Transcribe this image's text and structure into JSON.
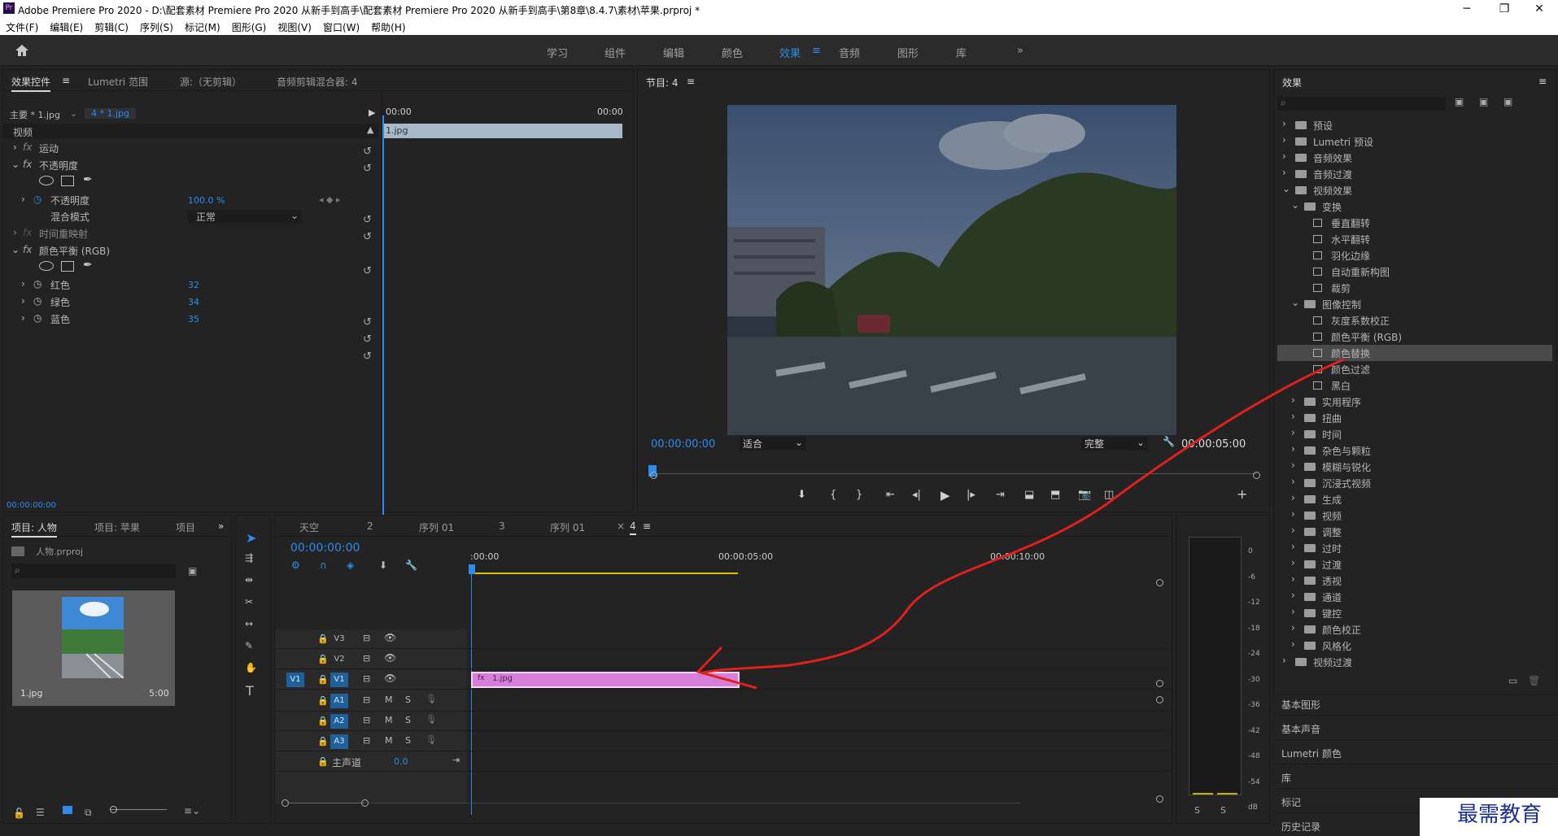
{
  "titlebar": {
    "logo": "Pr",
    "title": "Adobe Premiere Pro 2020 - D:\\配套素材 Premiere Pro 2020 从新手到高手\\配套素材 Premiere Pro 2020 从新手到高手\\第8章\\8.4.7\\素材\\苹果.prproj *",
    "minimize": "─",
    "maximize": "❐",
    "close": "✕"
  },
  "menu": [
    "文件(F)",
    "编辑(E)",
    "剪辑(C)",
    "序列(S)",
    "标记(M)",
    "图形(G)",
    "视图(V)",
    "窗口(W)",
    "帮助(H)"
  ],
  "workspaces": {
    "home_icon": "home-icon",
    "items": [
      "学习",
      "组件",
      "编辑",
      "颜色",
      "效果",
      "音频",
      "图形",
      "库"
    ],
    "active": "效果",
    "more": "»"
  },
  "effect_controls": {
    "tabs": [
      "效果控件",
      "Lumetri 范围",
      "源:（无剪辑）",
      "音频剪辑混合器: 4"
    ],
    "menu_icon": "≡",
    "master": "主要 * 1.jpg",
    "seq_clip": "4 * 1.jpg",
    "ruler_start": "00:00",
    "ruler_end": "00:00",
    "clip_label": "1.jpg",
    "section_video": "视频",
    "motion": "运动",
    "opacity": "不透明度",
    "opacity_value_label": "不透明度",
    "opacity_value": "100.0 %",
    "blend_mode_label": "混合模式",
    "blend_mode": "正常",
    "time_remap": "时间重映射",
    "color_balance": "颜色平衡 (RGB)",
    "red_label": "红色",
    "red": "32",
    "green_label": "绿色",
    "green": "34",
    "blue_label": "蓝色",
    "blue": "35",
    "timecode": "00:00:00:00"
  },
  "program": {
    "title": "节目: 4",
    "timecode": "00:00:00:00",
    "fit": "适合",
    "quality": "完整",
    "duration": "00:00:05:00",
    "add_icon": "+"
  },
  "project": {
    "tabs": [
      "项目: 人物",
      "项目: 苹果",
      "项目"
    ],
    "more": "»",
    "file": "人物.prproj",
    "clip_name": "1.jpg",
    "clip_duration": "5:00"
  },
  "timeline": {
    "tabs": [
      "天空",
      "2",
      "序列 01",
      "3",
      "序列 01",
      "4"
    ],
    "close_mark": "×",
    "timecode": "00:00:00:00",
    "ruler": [
      ":00:00",
      "00:00:05:00",
      "00:00:10:00"
    ],
    "video_tracks": [
      "V3",
      "V2",
      "V1"
    ],
    "audio_tracks": [
      "A1",
      "A2",
      "A3"
    ],
    "source_v1": "V1",
    "master": "主声道",
    "master_value": "0.0",
    "clip": "1.jpg",
    "m": "M",
    "s": "S"
  },
  "meter": {
    "labels": [
      "0",
      "-6",
      "-12",
      "-18",
      "-24",
      "-30",
      "-36",
      "-42",
      "-48",
      "-54",
      "dB"
    ],
    "solo": [
      "S",
      "S"
    ]
  },
  "effects": {
    "title": "效果",
    "menu_icon": "≡",
    "tree": [
      {
        "label": "预设",
        "level": 0,
        "open": false
      },
      {
        "label": "Lumetri 预设",
        "level": 0,
        "open": false
      },
      {
        "label": "音频效果",
        "level": 0,
        "open": false
      },
      {
        "label": "音频过渡",
        "level": 0,
        "open": false
      },
      {
        "label": "视频效果",
        "level": 0,
        "open": true
      },
      {
        "label": "变换",
        "level": 1,
        "open": true
      },
      {
        "label": "垂直翻转",
        "level": 2,
        "fx": true
      },
      {
        "label": "水平翻转",
        "level": 2,
        "fx": true
      },
      {
        "label": "羽化边缘",
        "level": 2,
        "fx": true
      },
      {
        "label": "自动重新构图",
        "level": 2,
        "fx": true
      },
      {
        "label": "裁剪",
        "level": 2,
        "fx": true
      },
      {
        "label": "图像控制",
        "level": 1,
        "open": true
      },
      {
        "label": "灰度系数校正",
        "level": 2,
        "fx": true
      },
      {
        "label": "颜色平衡 (RGB)",
        "level": 2,
        "fx": true
      },
      {
        "label": "颜色替换",
        "level": 2,
        "fx": true,
        "selected": true
      },
      {
        "label": "颜色过滤",
        "level": 2,
        "fx": true
      },
      {
        "label": "黑白",
        "level": 2,
        "fx": true
      },
      {
        "label": "实用程序",
        "level": 1
      },
      {
        "label": "扭曲",
        "level": 1
      },
      {
        "label": "时间",
        "level": 1
      },
      {
        "label": "杂色与颗粒",
        "level": 1
      },
      {
        "label": "模糊与锐化",
        "level": 1
      },
      {
        "label": "沉浸式视频",
        "level": 1
      },
      {
        "label": "生成",
        "level": 1
      },
      {
        "label": "视频",
        "level": 1
      },
      {
        "label": "调整",
        "level": 1
      },
      {
        "label": "过时",
        "level": 1
      },
      {
        "label": "过渡",
        "level": 1
      },
      {
        "label": "透视",
        "level": 1
      },
      {
        "label": "通道",
        "level": 1
      },
      {
        "label": "键控",
        "level": 1
      },
      {
        "label": "颜色校正",
        "level": 1
      },
      {
        "label": "风格化",
        "level": 1
      },
      {
        "label": "视频过渡",
        "level": 0
      }
    ],
    "collapsed_panels": [
      "基本图形",
      "基本声音",
      "Lumetri 颜色",
      "库",
      "标记",
      "历史记录"
    ]
  },
  "watermark": "最需教育",
  "colors": {
    "accent": "#2d8ceb",
    "clip": "#d77fd8",
    "annotation": "#e0201f"
  }
}
